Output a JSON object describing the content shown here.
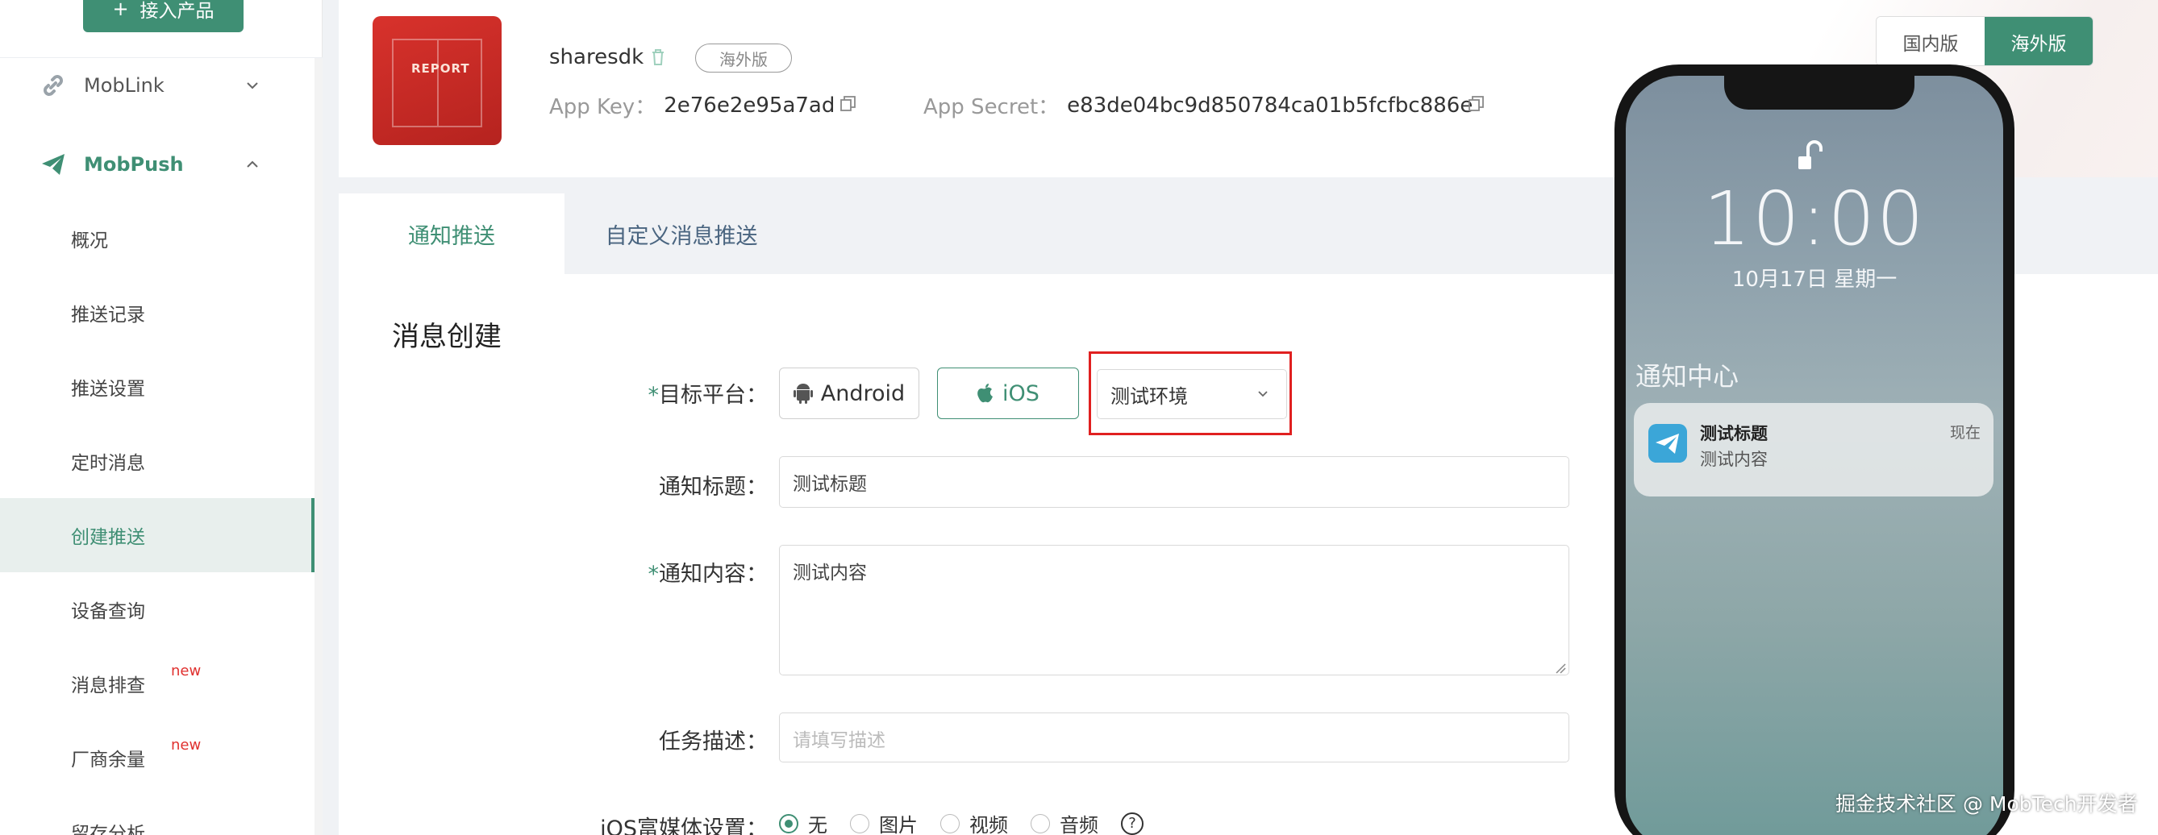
{
  "sidebar": {
    "add_product": "接入产品",
    "add_product_icon": "plus-icon",
    "groups": [
      {
        "label": "MobLink",
        "icon": "link-icon",
        "expanded": false
      },
      {
        "label": "MobPush",
        "icon": "paper-plane-icon",
        "expanded": true
      }
    ],
    "items": [
      {
        "label": "概况"
      },
      {
        "label": "推送记录"
      },
      {
        "label": "推送设置"
      },
      {
        "label": "定时消息"
      },
      {
        "label": "创建推送",
        "active": true
      },
      {
        "label": "设备查询"
      },
      {
        "label": "消息排查",
        "badge": "new"
      },
      {
        "label": "厂商余量",
        "badge": "new"
      },
      {
        "label": "留存分析"
      }
    ]
  },
  "app": {
    "name": "sharesdk",
    "region_tag": "海外版",
    "icon_text": "REPORT",
    "app_key_label": "App Key：",
    "app_key": "2e76e2e95a7ad",
    "app_secret_label": "App Secret：",
    "app_secret": "e83de04bc9d850784ca01b5fcfbc886e"
  },
  "region_switch": {
    "domestic": "国内版",
    "overseas": "海外版",
    "selected": "海外版"
  },
  "tabs": [
    {
      "label": "通知推送",
      "active": true
    },
    {
      "label": "自定义消息推送",
      "active": false
    }
  ],
  "form": {
    "section_title": "消息创建",
    "platform_label": "目标平台：",
    "platform_required": "*",
    "android_label": "Android",
    "ios_label": "iOS",
    "selected_platform": "iOS",
    "env_value": "测试环境",
    "title_label": "通知标题：",
    "title_value": "测试标题",
    "content_label": "通知内容：",
    "content_required": "*",
    "content_value": "测试内容",
    "desc_label": "任务描述：",
    "desc_placeholder": "请填写描述",
    "media_label": "iOS富媒体设置：",
    "media_options": [
      "无",
      "图片",
      "视频",
      "音频"
    ],
    "media_selected": "无",
    "help": "?"
  },
  "preview": {
    "time": "10:00",
    "date": "10月17日  星期一",
    "notification_center": "通知中心",
    "notif_title": "测试标题",
    "notif_body": "测试内容",
    "notif_time": "现在"
  },
  "watermark": "掘金技术社区 @ MobTech开发者",
  "colors": {
    "accent": "#3f8f74",
    "highlight_box": "#e02020",
    "badge_new": "#e0312f"
  }
}
